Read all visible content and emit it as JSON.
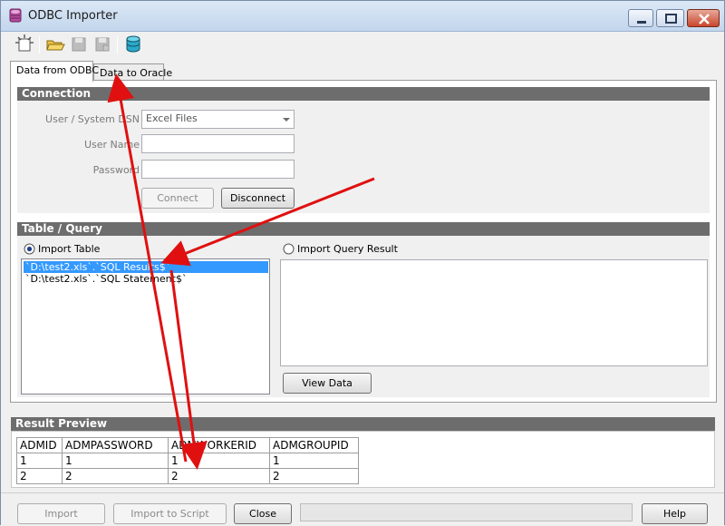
{
  "window": {
    "title": "ODBC Importer"
  },
  "icons": {
    "app": "database-app-icon",
    "new": "new-sparkle-icon",
    "open": "open-folder-icon",
    "save": "save-disk-icon",
    "save_as": "save-as-disk-icon",
    "connect": "database-cylinder-icon",
    "minimize": "minimize-icon",
    "maximize": "maximize-icon",
    "close": "close-icon"
  },
  "tabs": [
    {
      "label": "Data from ODBC",
      "active": true
    },
    {
      "label": "Data to Oracle",
      "active": false
    }
  ],
  "connection": {
    "header": "Connection",
    "dsn_label": "User / System DSN",
    "dsn_value": "Excel Files",
    "user_label": "User Name",
    "user_value": "",
    "password_label": "Password",
    "password_value": "",
    "connect_button": "Connect",
    "disconnect_button": "Disconnect"
  },
  "table_query": {
    "header": "Table / Query",
    "import_table_label": "Import Table",
    "import_table_selected": true,
    "tables": [
      {
        "name": "`D:\\test2.xls`.`SQL Results$`",
        "selected": true
      },
      {
        "name": "`D:\\test2.xls`.`SQL Statement$`",
        "selected": false
      }
    ],
    "import_query_label": "Import Query Result",
    "import_query_selected": false,
    "query_text": "",
    "view_data_button": "View Data"
  },
  "result_preview": {
    "header": "Result Preview",
    "columns": [
      "ADMID",
      "ADMPASSWORD",
      "ADMWORKERID",
      "ADMGROUPID"
    ],
    "rows": [
      [
        "1",
        "1",
        "1",
        "1"
      ],
      [
        "2",
        "2",
        "2",
        "2"
      ]
    ]
  },
  "bottom": {
    "import_button": "Import",
    "import_script_button": "Import to Script",
    "close_button": "Close",
    "help_button": "Help"
  },
  "colors": {
    "annotation_arrow": "#e01010",
    "section_header": "#6d6d6d",
    "selection": "#3399ff"
  }
}
